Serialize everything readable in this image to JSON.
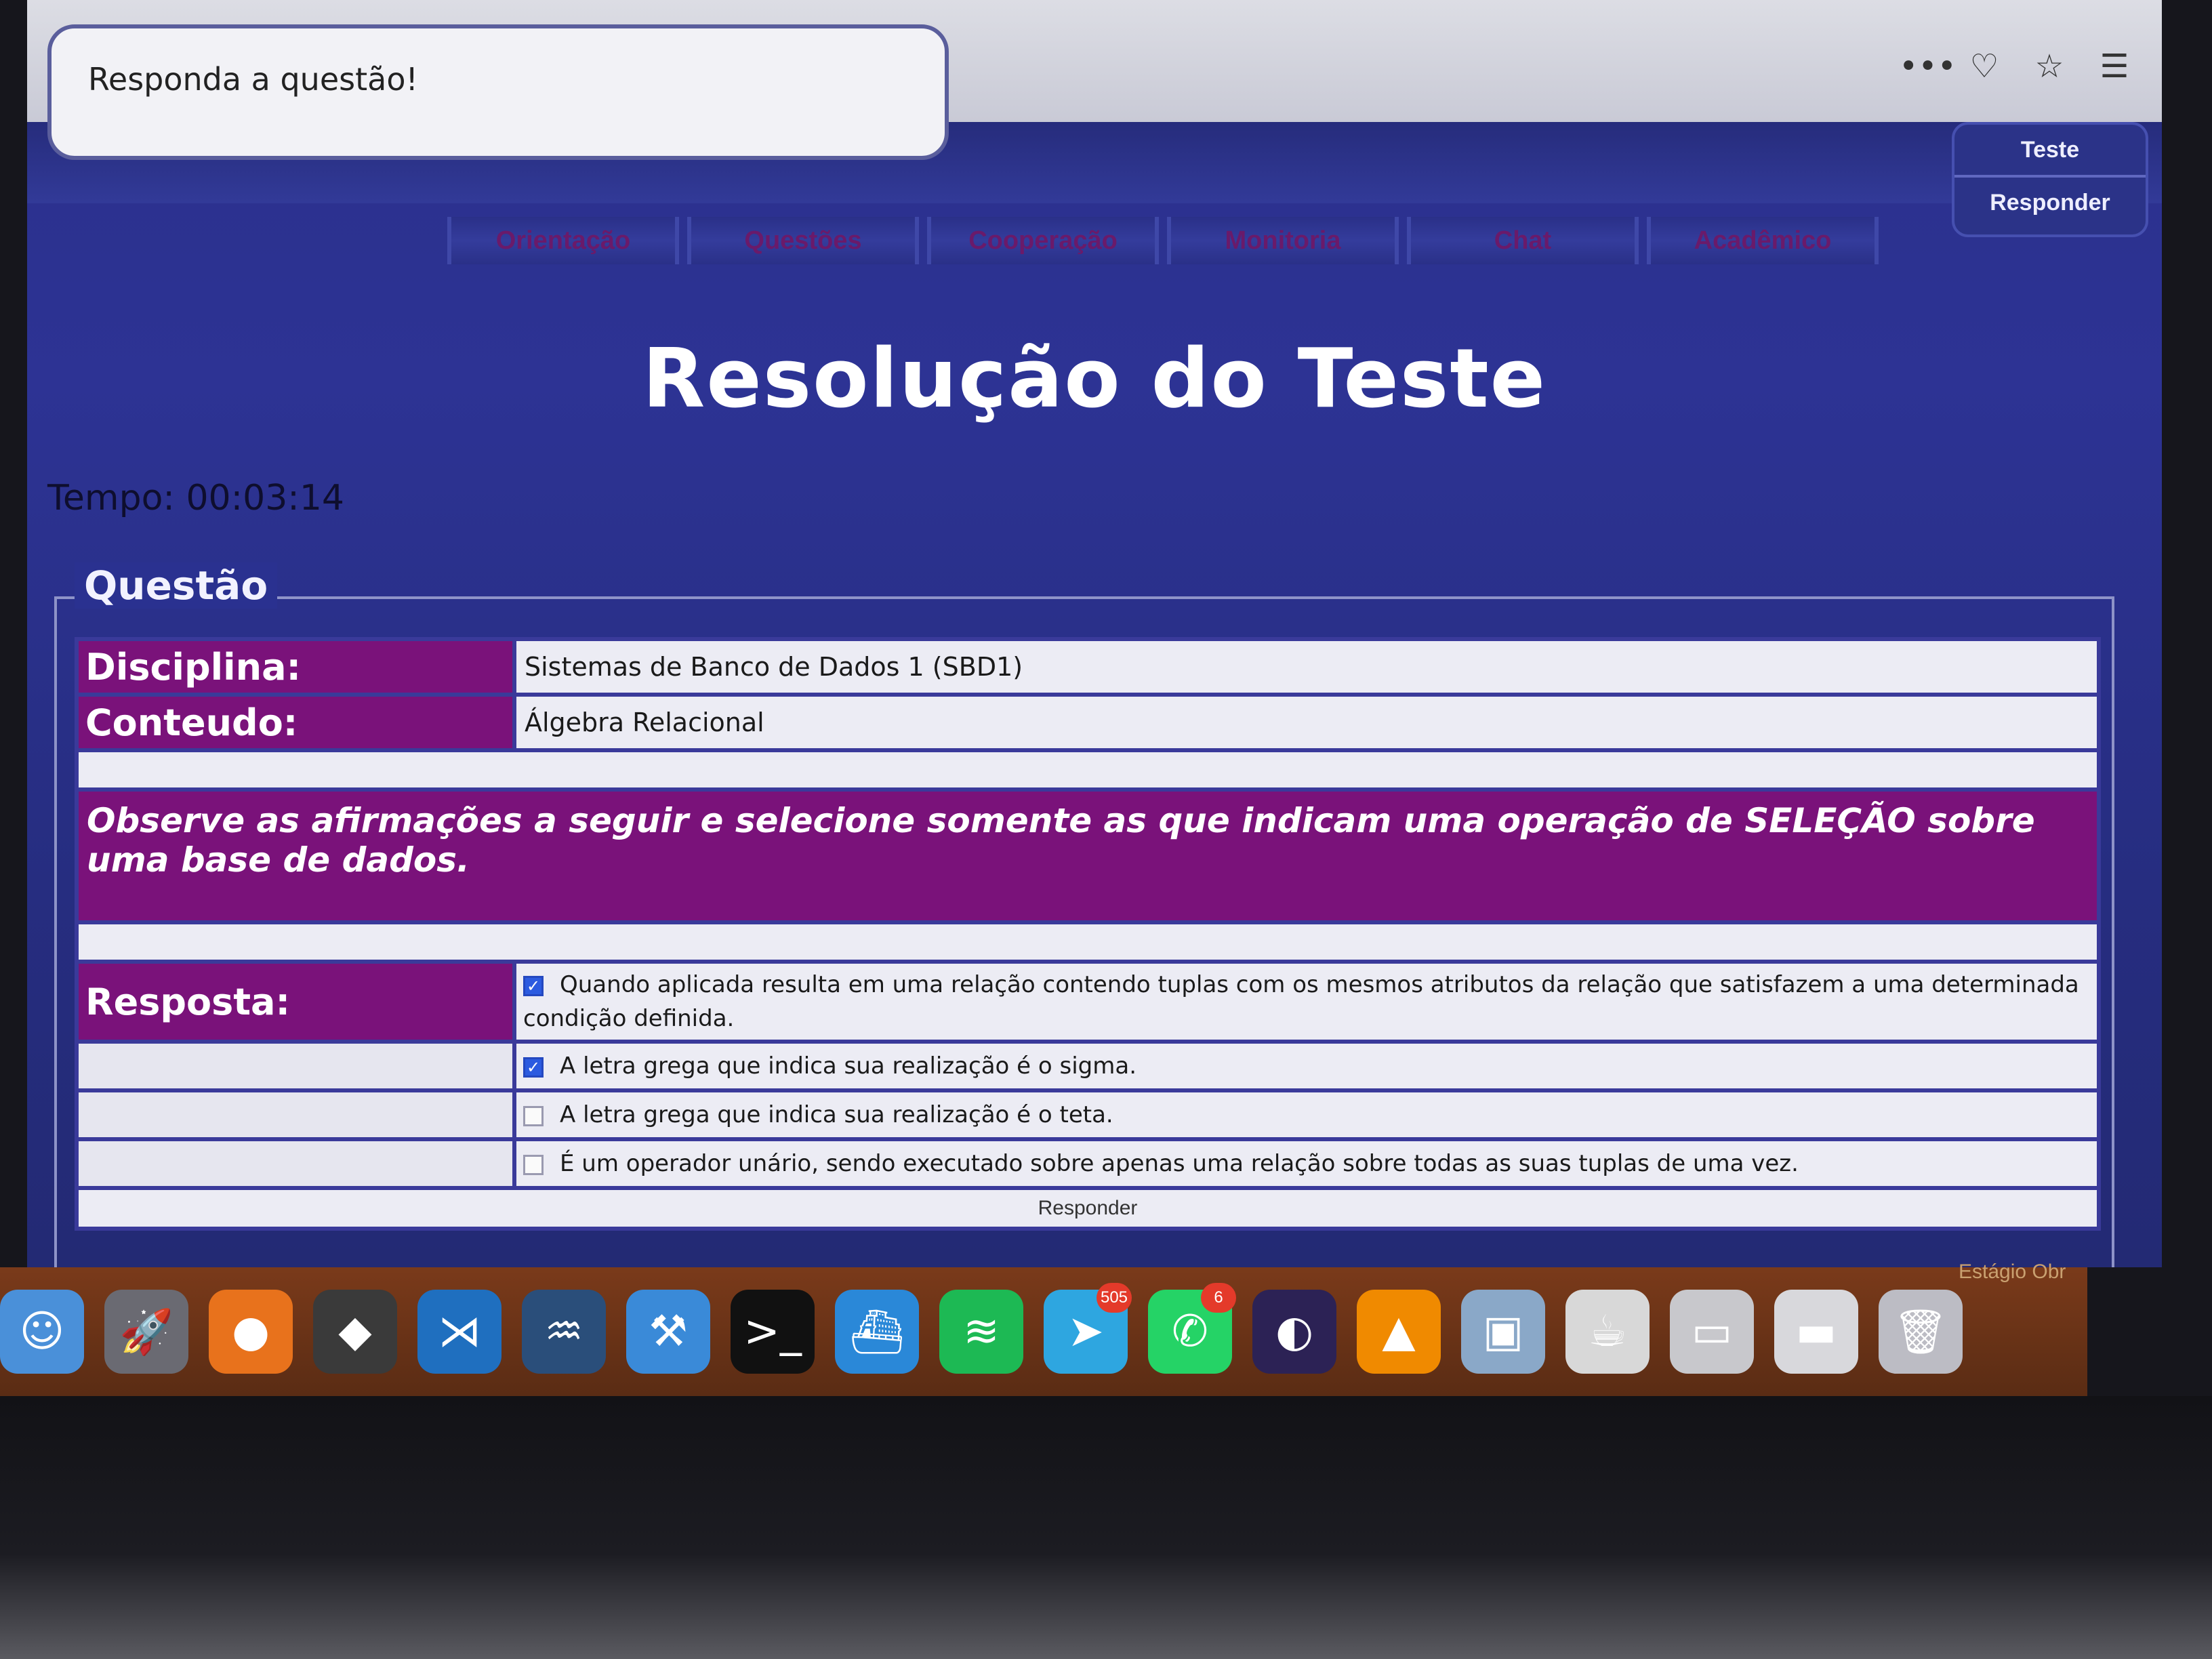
{
  "browser": {
    "status_text": "Responda a questão!",
    "icons": [
      "more-icon",
      "pocket-icon",
      "star-icon",
      "menu-icon"
    ]
  },
  "side_menu": {
    "items": [
      "Teste",
      "Responder"
    ]
  },
  "nav": {
    "tabs": [
      "Orientação",
      "Questões",
      "Cooperação",
      "Monitoria",
      "Chat",
      "Acadêmico"
    ]
  },
  "page": {
    "title": "Resolução do Teste",
    "timer": "Tempo: 00:03:14"
  },
  "question": {
    "legend": "Questão",
    "disciplina_label": "Disciplina:",
    "disciplina_value": "Sistemas de Banco de Dados 1 (SBD1)",
    "conteudo_label": "Conteudo:",
    "conteudo_value": "Álgebra Relacional",
    "statement": "Observe as afirmações a seguir e selecione somente as que indicam uma operação de SELEÇÃO sobre uma base de dados.",
    "resposta_label": "Resposta:",
    "options": [
      {
        "text": "Quando aplicada resulta em uma relação contendo tuplas com os mesmos atributos da relação que satisfazem a uma determinada condição definida.",
        "checked": true
      },
      {
        "text": "A letra grega que indica sua realização é o sigma.",
        "checked": true
      },
      {
        "text": "A letra grega que indica sua realização é o teta.",
        "checked": false
      },
      {
        "text": "É um operador unário, sendo executado sobre apenas uma relação sobre todas as suas tuplas de uma vez.",
        "checked": false
      }
    ],
    "submit_label": "Responder"
  },
  "dock": {
    "apps": [
      {
        "name": "finder-icon",
        "color": "#4a90d9",
        "glyph": "☺"
      },
      {
        "name": "launchpad-icon",
        "color": "#6a6a72",
        "glyph": "🚀"
      },
      {
        "name": "firefox-icon",
        "color": "#e8721c",
        "glyph": "●"
      },
      {
        "name": "sublime-icon",
        "color": "#3a3a3a",
        "glyph": "◆"
      },
      {
        "name": "vscode-icon",
        "color": "#1f6fbf",
        "glyph": "⋊"
      },
      {
        "name": "mysql-workbench-icon",
        "color": "#2a4e7a",
        "glyph": "♒"
      },
      {
        "name": "xcode-icon",
        "color": "#3a8ad8",
        "glyph": "⚒"
      },
      {
        "name": "terminal-icon",
        "color": "#111111",
        "glyph": ">_"
      },
      {
        "name": "docker-icon",
        "color": "#2a88d8",
        "glyph": "⛴"
      },
      {
        "name": "spotify-icon",
        "color": "#1db954",
        "glyph": "≋"
      },
      {
        "name": "telegram-icon",
        "color": "#2ea6e0",
        "glyph": "➤",
        "badge": "505"
      },
      {
        "name": "whatsapp-icon",
        "color": "#25d366",
        "glyph": "✆",
        "badge": "6"
      },
      {
        "name": "eclipse-icon",
        "color": "#2c2255",
        "glyph": "◐"
      },
      {
        "name": "vlc-icon",
        "color": "#f08a00",
        "glyph": "▲"
      },
      {
        "name": "preview-icon",
        "color": "#8aa8c8",
        "glyph": "▣"
      },
      {
        "name": "java-icon",
        "color": "#d8d8d8",
        "glyph": "☕"
      },
      {
        "name": "screen-sharing-icon",
        "color": "#c8c8cc",
        "glyph": "▭"
      },
      {
        "name": "desktop-folder-icon",
        "color": "#d8d8dc",
        "glyph": "▬"
      },
      {
        "name": "trash-icon",
        "color": "#bcbcc4",
        "glyph": "🗑"
      }
    ],
    "stack_label": "Estágio Obr"
  }
}
